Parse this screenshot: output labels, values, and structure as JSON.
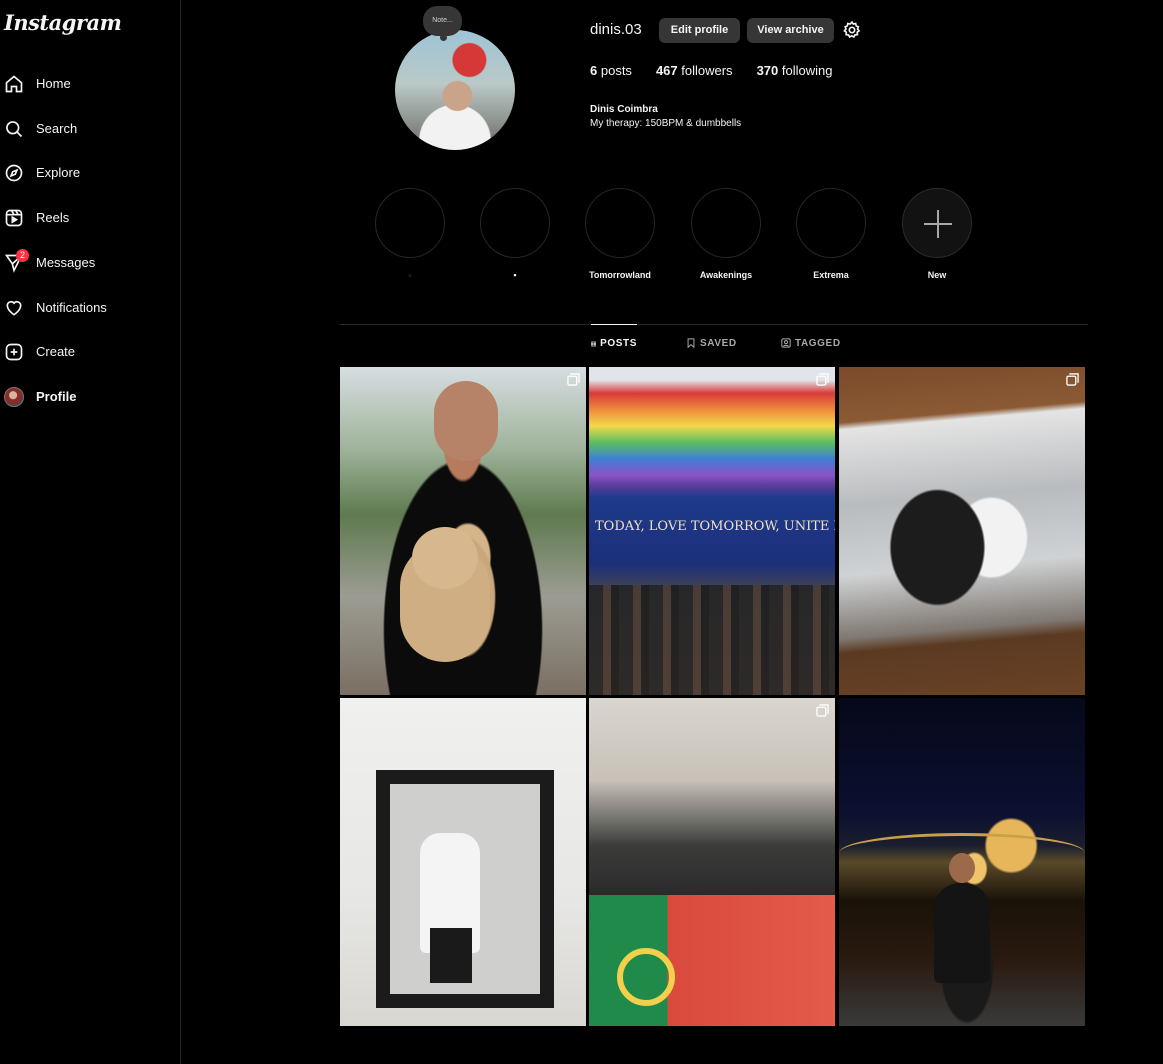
{
  "app": {
    "logo_text": "Instagram"
  },
  "sidebar": {
    "items": [
      {
        "label": "Home",
        "icon": "home-icon"
      },
      {
        "label": "Search",
        "icon": "search-icon"
      },
      {
        "label": "Explore",
        "icon": "compass-icon"
      },
      {
        "label": "Reels",
        "icon": "reels-icon"
      },
      {
        "label": "Messages",
        "icon": "messages-icon",
        "badge": "2"
      },
      {
        "label": "Notifications",
        "icon": "heart-icon"
      },
      {
        "label": "Create",
        "icon": "plus-square-icon"
      },
      {
        "label": "Profile",
        "icon": "avatar"
      }
    ]
  },
  "profile": {
    "note": "Note...",
    "username": "dinis.03",
    "edit_profile": "Edit profile",
    "view_archive": "View archive",
    "posts_count": "6",
    "posts_label": "posts",
    "followers_count": "467",
    "followers_label": "followers",
    "following_count": "370",
    "following_label": "following",
    "full_name": "Dinis Coimbra",
    "bio": "My therapy: 150BPM & dumbbells"
  },
  "highlights": [
    {
      "label": "▫"
    },
    {
      "label": "▪"
    },
    {
      "label": "Tomorrowland"
    },
    {
      "label": "Awakenings"
    },
    {
      "label": "Extrema"
    },
    {
      "label": "New"
    }
  ],
  "tabs": {
    "posts": "POSTS",
    "saved": "SAVED",
    "tagged": "TAGGED"
  },
  "post_text": {
    "p2_banner": "TODAY, LOVE TOMORROW, UNITE F"
  },
  "colors": {
    "background": "#000000",
    "text": "#f5f5f5",
    "button": "#363636",
    "badge": "#ff3040",
    "divider": "#262626"
  }
}
